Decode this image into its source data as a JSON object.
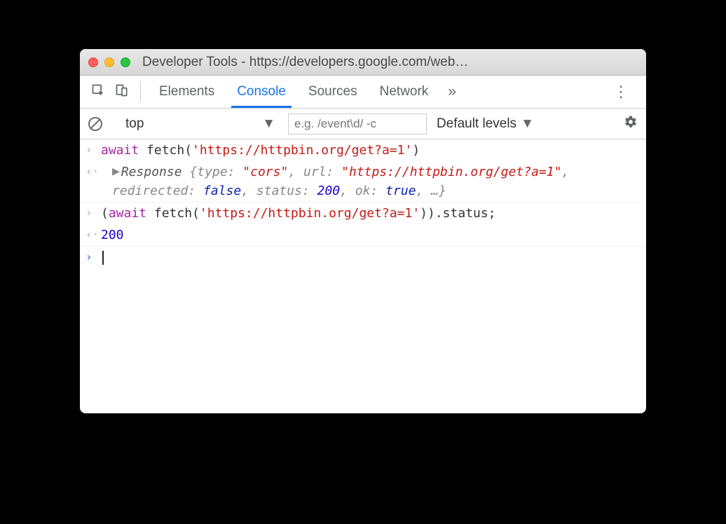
{
  "window": {
    "title": "Developer Tools - https://developers.google.com/web…"
  },
  "tabs": {
    "items": [
      "Elements",
      "Console",
      "Sources",
      "Network"
    ],
    "active": "Console",
    "more": "»"
  },
  "filterbar": {
    "context": "top",
    "filter_placeholder": "e.g. /event\\d/ -c",
    "levels_label": "Default levels"
  },
  "console": {
    "line1": {
      "kw": "await",
      "fn": " fetch(",
      "str": "'https://httpbin.org/get?a=1'",
      "close": ")"
    },
    "response": {
      "label": "Response ",
      "open": "{",
      "p_type": "type: ",
      "v_type": "\"cors\"",
      "c1": ", ",
      "p_url": "url: ",
      "v_url": "\"https://httpbin.org/get?a=1\"",
      "c2": ", ",
      "p_redir": "redirected: ",
      "v_redir": "false",
      "c3": ", ",
      "p_status": "status: ",
      "v_status": "200",
      "c4": ", ",
      "p_ok": "ok: ",
      "v_ok": "true",
      "c5": ", …",
      "close": "}"
    },
    "line2": {
      "open": "(",
      "kw": "await",
      "fn": " fetch(",
      "str": "'https://httpbin.org/get?a=1'",
      "close": ")).status;"
    },
    "out2": "200"
  }
}
